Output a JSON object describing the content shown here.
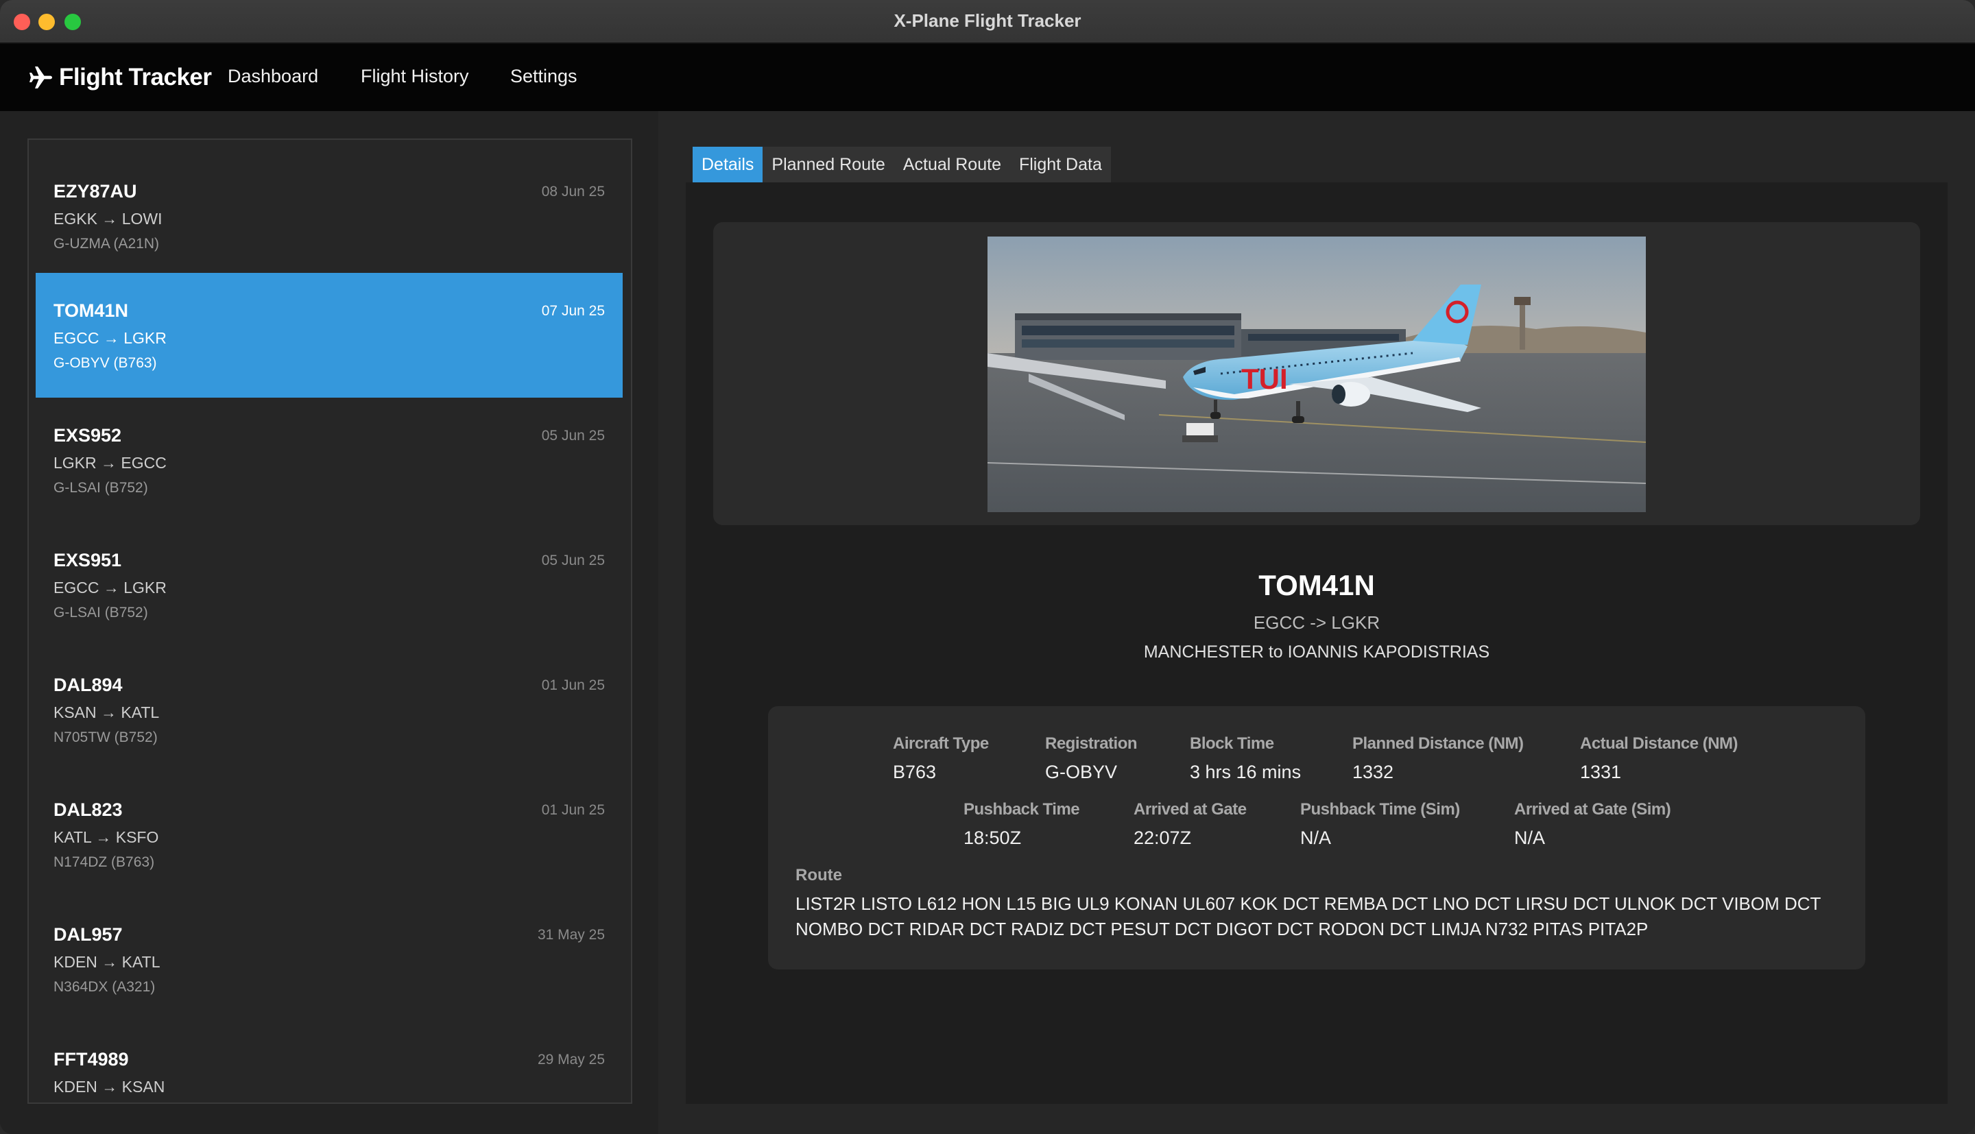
{
  "window": {
    "title": "X-Plane Flight Tracker"
  },
  "header": {
    "brand": "Flight Tracker",
    "nav": [
      "Dashboard",
      "Flight History",
      "Settings"
    ]
  },
  "flights": [
    {
      "callsign": "EZY87AU",
      "date": "08 Jun 25",
      "route": "EGKK → LOWI",
      "reg": "G-UZMA (A21N)",
      "selected": false
    },
    {
      "callsign": "TOM41N",
      "date": "07 Jun 25",
      "route": "EGCC → LGKR",
      "reg": "G-OBYV (B763)",
      "selected": true
    },
    {
      "callsign": "EXS952",
      "date": "05 Jun 25",
      "route": "LGKR → EGCC",
      "reg": "G-LSAI (B752)",
      "selected": false
    },
    {
      "callsign": "EXS951",
      "date": "05 Jun 25",
      "route": "EGCC → LGKR",
      "reg": "G-LSAI (B752)",
      "selected": false
    },
    {
      "callsign": "DAL894",
      "date": "01 Jun 25",
      "route": "KSAN → KATL",
      "reg": "N705TW (B752)",
      "selected": false
    },
    {
      "callsign": "DAL823",
      "date": "01 Jun 25",
      "route": "KATL → KSFO",
      "reg": "N174DZ (B763)",
      "selected": false
    },
    {
      "callsign": "DAL957",
      "date": "31 May 25",
      "route": "KDEN → KATL",
      "reg": "N364DX (A321)",
      "selected": false
    },
    {
      "callsign": "FFT4989",
      "date": "29 May 25",
      "route": "KDEN → KSAN",
      "reg": "",
      "selected": false
    }
  ],
  "tabs": [
    {
      "label": "Details",
      "active": true
    },
    {
      "label": "Planned Route",
      "active": false
    },
    {
      "label": "Actual Route",
      "active": false
    },
    {
      "label": "Flight Data",
      "active": false
    }
  ],
  "detail": {
    "callsign": "TOM41N",
    "route": "EGCC -> LGKR",
    "description": "MANCHESTER to IOANNIS KAPODISTRIAS",
    "row1": [
      {
        "label": "Aircraft Type",
        "value": "B763"
      },
      {
        "label": "Registration",
        "value": "G-OBYV"
      },
      {
        "label": "Block Time",
        "value": "3 hrs 16 mins"
      },
      {
        "label": "Planned Distance (NM)",
        "value": "1332"
      },
      {
        "label": "Actual Distance (NM)",
        "value": "1331"
      }
    ],
    "row2": [
      {
        "label": "Pushback Time",
        "value": "18:50Z"
      },
      {
        "label": "Arrived at Gate",
        "value": "22:07Z"
      },
      {
        "label": "Pushback Time (Sim)",
        "value": "N/A"
      },
      {
        "label": "Arrived at Gate (Sim)",
        "value": "N/A"
      }
    ],
    "route_label": "Route",
    "route_string": "LIST2R LISTO L612 HON L15 BIG UL9 KONAN UL607 KOK DCT REMBA DCT LNO DCT LIRSU DCT ULNOK DCT VIBOM DCT NOMBO DCT RIDAR DCT RADIZ DCT PESUT DCT DIGOT DCT RODON DCT LIMJA N732 PITAS PITA2P",
    "photo_livery": "TUI"
  },
  "colors": {
    "accent": "#3598dc",
    "background": "#1e1e1e",
    "card": "#2b2b2b",
    "header": "#050505"
  }
}
